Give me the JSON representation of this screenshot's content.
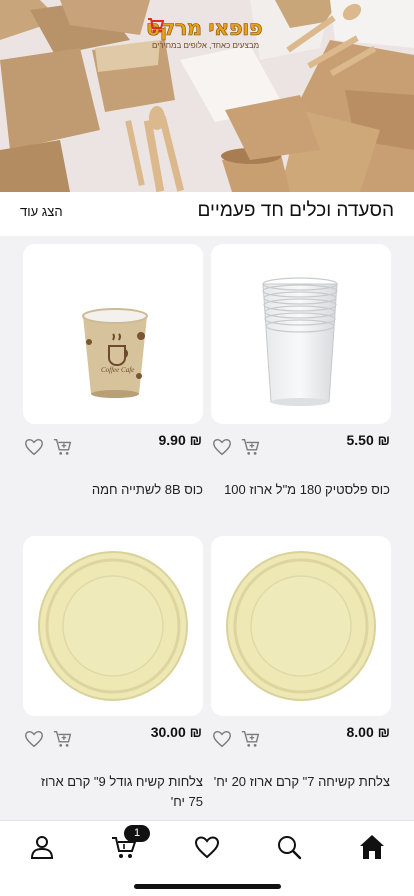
{
  "banner": {
    "logo_text": "פופאי מרקט",
    "logo_tagline": "מבצעים כאחד, אלופים במחירים"
  },
  "section": {
    "title": "הסעדה וכלים חד פעמיים",
    "show_more": "הצג עוד"
  },
  "products": [
    {
      "name": "כוס פלסטיק 180 מ\"ל ארוז 100",
      "price": "5.50 ₪"
    },
    {
      "name": "כוס 8B לשתייה חמה",
      "price": "9.90 ₪"
    },
    {
      "name": "צלחת קשיחה 7\" קרם ארוז 20 יח'",
      "price": "8.00 ₪"
    },
    {
      "name": "צלחות קשיח גודל 9\" קרם ארוז 75 יח'",
      "price": "30.00 ₪"
    }
  ],
  "cup_text": "Coffee Cafe",
  "cart_count": "1",
  "nav": [
    "home-icon",
    "search-icon",
    "heart-icon",
    "cart-icon",
    "user-icon"
  ],
  "colors": {
    "accent": "#111111",
    "background": "#f2f2f4",
    "plate": "#ede8b4"
  }
}
